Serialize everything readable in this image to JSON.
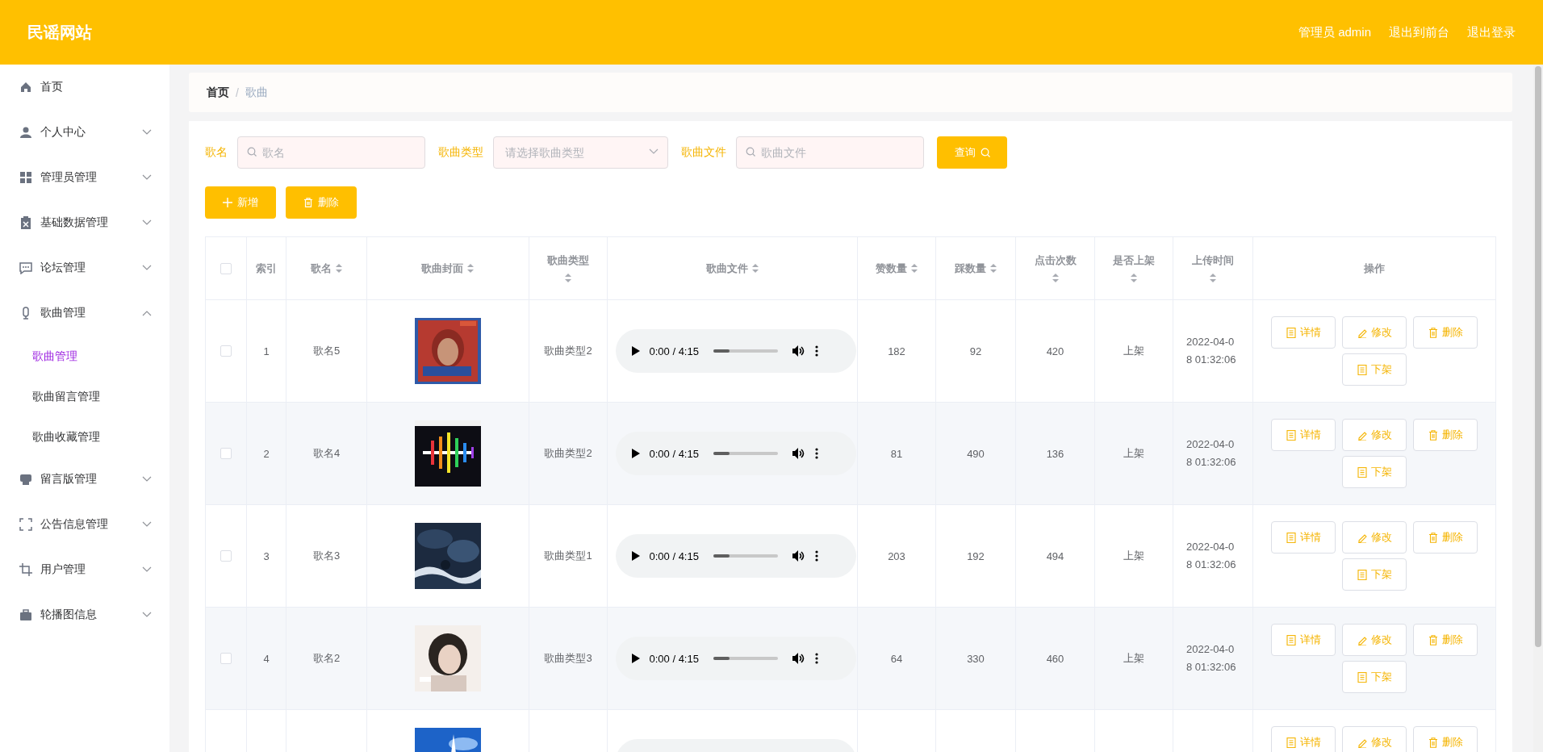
{
  "header": {
    "title": "民谣网站",
    "links": [
      "管理员 admin",
      "退出到前台",
      "退出登录"
    ]
  },
  "sidebar": {
    "items": [
      {
        "label": "首页",
        "expandable": false
      },
      {
        "label": "个人中心",
        "expandable": true,
        "expanded": false
      },
      {
        "label": "管理员管理",
        "expandable": true,
        "expanded": false
      },
      {
        "label": "基础数据管理",
        "expandable": true,
        "expanded": false
      },
      {
        "label": "论坛管理",
        "expandable": true,
        "expanded": false
      },
      {
        "label": "歌曲管理",
        "expandable": true,
        "expanded": true,
        "children": [
          {
            "label": "歌曲管理",
            "selected": true
          },
          {
            "label": "歌曲留言管理",
            "selected": false
          },
          {
            "label": "歌曲收藏管理",
            "selected": false
          }
        ]
      },
      {
        "label": "留言版管理",
        "expandable": true,
        "expanded": false
      },
      {
        "label": "公告信息管理",
        "expandable": true,
        "expanded": false
      },
      {
        "label": "用户管理",
        "expandable": true,
        "expanded": false
      },
      {
        "label": "轮播图信息",
        "expandable": true,
        "expanded": false
      }
    ]
  },
  "breadcrumb": {
    "separator": "/",
    "items": [
      "首页",
      "歌曲"
    ]
  },
  "filters": [
    {
      "kind": "text",
      "label": "歌名",
      "placeholder": "歌名"
    },
    {
      "kind": "select",
      "label": "歌曲类型",
      "placeholder": "请选择歌曲类型"
    },
    {
      "kind": "text",
      "label": "歌曲文件",
      "placeholder": "歌曲文件"
    }
  ],
  "search_button": "查询",
  "toolbar": [
    {
      "kind": "add",
      "label": "新增"
    },
    {
      "kind": "delete",
      "label": "删除"
    }
  ],
  "table": {
    "columns": [
      {
        "kind": "checkbox",
        "checked": false
      },
      {
        "label": "索引",
        "sortable": false
      },
      {
        "label": "歌名",
        "sortable": true
      },
      {
        "label": "歌曲封面",
        "sortable": true
      },
      {
        "label": "歌曲类型",
        "sortable": true
      },
      {
        "label": "歌曲文件",
        "sortable": true
      },
      {
        "label": "赞数量",
        "sortable": true
      },
      {
        "label": "踩数量",
        "sortable": true
      },
      {
        "label": "点击次数",
        "sortable": true
      },
      {
        "label": "是否上架",
        "sortable": true
      },
      {
        "label": "上传时间",
        "sortable": true
      },
      {
        "label": "操作",
        "sortable": false
      }
    ],
    "rows": [
      {
        "checked": false,
        "index": "1",
        "name": "歌名5",
        "cover": {
          "kind": "picture"
        },
        "type": "歌曲类型2",
        "file": {
          "kind": "player",
          "time": "0:00 / 4:15"
        },
        "likes": "182",
        "dislikes": "92",
        "clicks": "420",
        "listed": "上架",
        "upload_time": "2022-04-08 01:32:06",
        "actions": [
          {
            "kind": "detail",
            "label": "详情"
          },
          {
            "kind": "edit",
            "label": "修改"
          },
          {
            "kind": "delete",
            "label": "删除"
          },
          {
            "kind": "unlist",
            "label": "下架"
          }
        ]
      },
      {
        "checked": false,
        "index": "2",
        "name": "歌名4",
        "cover": {
          "kind": "picture"
        },
        "type": "歌曲类型2",
        "file": {
          "kind": "player",
          "time": "0:00 / 4:15"
        },
        "likes": "81",
        "dislikes": "490",
        "clicks": "136",
        "listed": "上架",
        "upload_time": "2022-04-08 01:32:06",
        "actions": [
          {
            "kind": "detail",
            "label": "详情"
          },
          {
            "kind": "edit",
            "label": "修改"
          },
          {
            "kind": "delete",
            "label": "删除"
          },
          {
            "kind": "unlist",
            "label": "下架"
          }
        ]
      },
      {
        "checked": false,
        "index": "3",
        "name": "歌名3",
        "cover": {
          "kind": "picture"
        },
        "type": "歌曲类型1",
        "file": {
          "kind": "player",
          "time": "0:00 / 4:15"
        },
        "likes": "203",
        "dislikes": "192",
        "clicks": "494",
        "listed": "上架",
        "upload_time": "2022-04-08 01:32:06",
        "actions": [
          {
            "kind": "detail",
            "label": "详情"
          },
          {
            "kind": "edit",
            "label": "修改"
          },
          {
            "kind": "delete",
            "label": "删除"
          },
          {
            "kind": "unlist",
            "label": "下架"
          }
        ]
      },
      {
        "checked": false,
        "index": "4",
        "name": "歌名2",
        "cover": {
          "kind": "picture"
        },
        "type": "歌曲类型3",
        "file": {
          "kind": "player",
          "time": "0:00 / 4:15"
        },
        "likes": "64",
        "dislikes": "330",
        "clicks": "460",
        "listed": "上架",
        "upload_time": "2022-04-08 01:32:06",
        "actions": [
          {
            "kind": "detail",
            "label": "详情"
          },
          {
            "kind": "edit",
            "label": "修改"
          },
          {
            "kind": "delete",
            "label": "删除"
          },
          {
            "kind": "unlist",
            "label": "下架"
          }
        ]
      },
      {
        "cover": {
          "kind": "picture"
        },
        "file": {
          "kind": "player"
        },
        "actions": [
          {
            "kind": "detail",
            "label": "详情"
          },
          {
            "kind": "edit",
            "label": "修改"
          },
          {
            "kind": "delete",
            "label": "删除"
          }
        ]
      }
    ]
  }
}
